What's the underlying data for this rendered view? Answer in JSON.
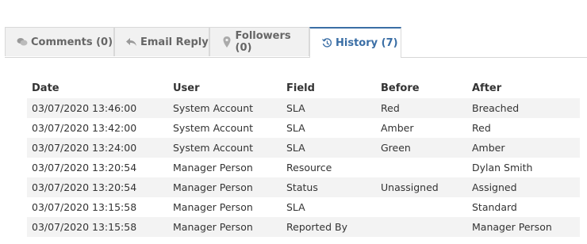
{
  "tabs": [
    {
      "label": "Comments (0)",
      "icon": "comments-icon",
      "active": false
    },
    {
      "label": "Email Reply",
      "icon": "reply-icon",
      "active": false
    },
    {
      "label": "Followers (0)",
      "icon": "pin-icon",
      "active": false
    },
    {
      "label": "History (7)",
      "icon": "history-icon",
      "active": true
    }
  ],
  "history": {
    "headers": [
      "Date",
      "User",
      "Field",
      "Before",
      "After"
    ],
    "rows": [
      [
        "03/07/2020 13:46:00",
        "System Account",
        "SLA",
        "Red",
        "Breached"
      ],
      [
        "03/07/2020 13:42:00",
        "System Account",
        "SLA",
        "Amber",
        "Red"
      ],
      [
        "03/07/2020 13:24:00",
        "System Account",
        "SLA",
        "Green",
        "Amber"
      ],
      [
        "03/07/2020 13:20:54",
        "Manager Person",
        "Resource",
        "",
        "Dylan Smith"
      ],
      [
        "03/07/2020 13:20:54",
        "Manager Person",
        "Status",
        "Unassigned",
        "Assigned"
      ],
      [
        "03/07/2020 13:15:58",
        "Manager Person",
        "SLA",
        "",
        "Standard"
      ],
      [
        "03/07/2020 13:15:58",
        "Manager Person",
        "Reported By",
        "",
        "Manager Person"
      ]
    ]
  },
  "colors": {
    "accent": "#3a6ea5",
    "tab_bg": "#f1f1f1",
    "row_stripe": "#f3f3f3"
  }
}
